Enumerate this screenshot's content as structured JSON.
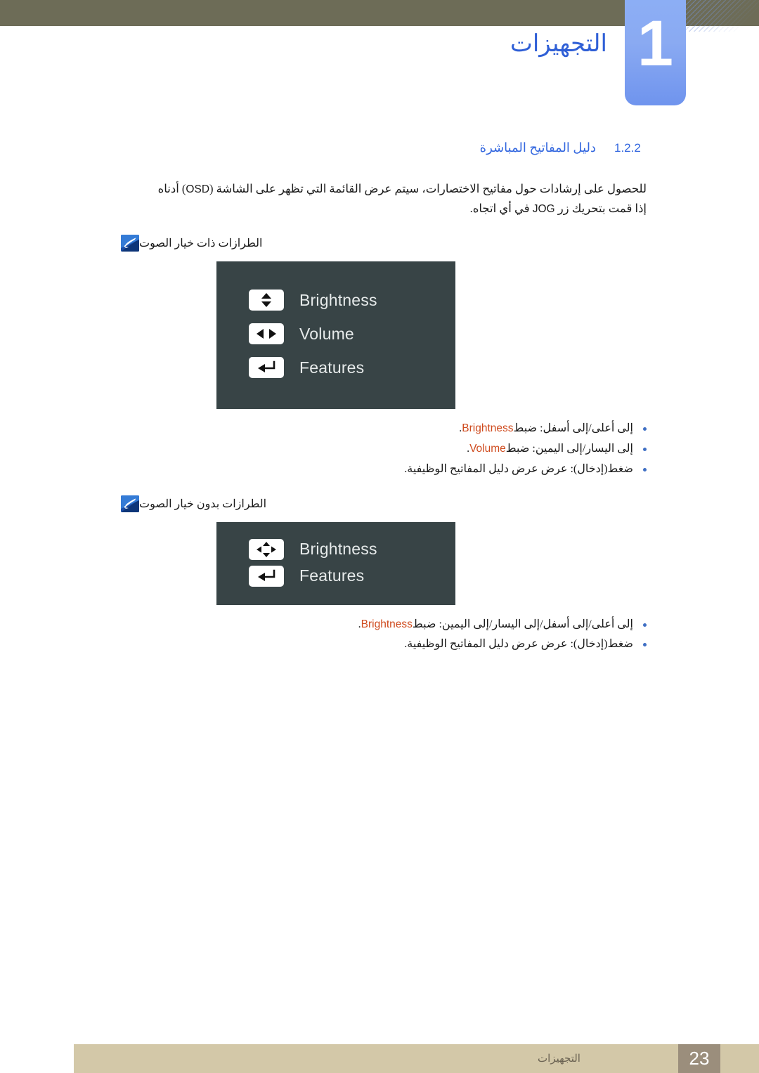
{
  "header": {
    "chapter_number": "1",
    "chapter_title": "التجهيزات"
  },
  "section": {
    "number": "1.2.2",
    "title": "دليل المفاتيح المباشرة"
  },
  "paragraph": {
    "part_a": "للحصول على إرشادات حول مفاتيح الاختصارات، سيتم عرض القائمة التي تظهر على الشاشة (",
    "osd_abbr": "OSD",
    "part_b": ") أدناه إذا قمت بتحريك زر ",
    "jog_abbr": "JOG",
    "part_c": " في أي اتجاه."
  },
  "notes": {
    "with_audio": "الطرازات ذات خيار الصوت",
    "without_audio": "الطرازات بدون خيار الصوت"
  },
  "osd_with_audio": {
    "rows": [
      {
        "icon": "up-down-arrows-icon",
        "label": "Brightness"
      },
      {
        "icon": "left-right-arrows-icon",
        "label": "Volume"
      },
      {
        "icon": "enter-arrow-icon",
        "label": "Features"
      }
    ]
  },
  "osd_without_audio": {
    "rows": [
      {
        "icon": "four-way-diamond-icon",
        "label": "Brightness"
      },
      {
        "icon": "enter-arrow-icon",
        "label": "Features"
      }
    ]
  },
  "bullets_with_audio": [
    {
      "pre": "إلى أعلى/إلى أسفل: ضبط",
      "highlight": "Brightness",
      "post": "."
    },
    {
      "pre": "إلى اليسار/إلى اليمين: ضبط",
      "highlight": "Volume",
      "post": "."
    },
    {
      "pre": "ضغط(إدخال): عرض عرض دليل المفاتيح الوظيفية.",
      "highlight": "",
      "post": ""
    }
  ],
  "bullets_without_audio": [
    {
      "pre": "إلى أعلى/إلى أسفل/إلى اليسار/إلى اليمين: ضبط",
      "highlight": "Brightness",
      "post": "."
    },
    {
      "pre": "ضغط(إدخال): عرض عرض دليل المفاتيح الوظيفية.",
      "highlight": "",
      "post": ""
    }
  ],
  "footer": {
    "label": "التجهيزات",
    "page_number": "23"
  },
  "colors": {
    "header_bar": "#6d6c57",
    "chapter_tab": "#8aaaf2",
    "heading_blue": "#3367df",
    "osd_background": "#384446",
    "highlight_orange": "#cf4a1d",
    "footer_bar": "#d3c8a8",
    "footer_page_box": "#9b8e7c"
  }
}
